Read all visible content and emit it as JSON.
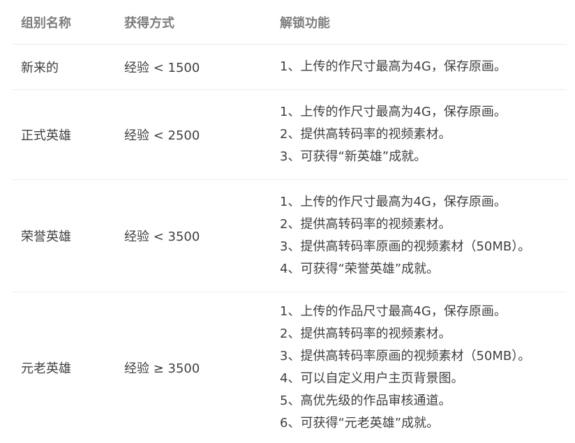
{
  "table": {
    "headers": [
      "组别名称",
      "获得方式",
      "解锁功能"
    ],
    "rows": [
      {
        "group": "新来的",
        "method": "经验 < 1500",
        "features": [
          "1、上传的作尺寸最高为4G，保存原画。"
        ]
      },
      {
        "group": "正式英雄",
        "method": "经验 < 2500",
        "features": [
          "1、上传的作尺寸最高为4G，保存原画。",
          "2、提供高转码率的视频素材。",
          "3、可获得“新英雄”成就。"
        ]
      },
      {
        "group": "荣誉英雄",
        "method": "经验 < 3500",
        "features": [
          "1、上传的作尺寸最高为4G，保存原画。",
          "2、提供高转码率的视频素材。",
          "3、提供高转码率原画的视频素材（50MB）。",
          "4、可获得“荣誉英雄”成就。"
        ]
      },
      {
        "group": "元老英雄",
        "method": "经验 ≥ 3500",
        "features": [
          "1、上传的作品尺寸最高4G，保存原画。",
          "2、提供高转码率的视频素材。",
          "3、提供高转码率原画的视频素材（50MB）。",
          "4、可以自定义用户主页背景图。",
          "5、高优先级的作品审核通道。",
          "6、可获得“元老英雄”成就。"
        ]
      }
    ]
  }
}
